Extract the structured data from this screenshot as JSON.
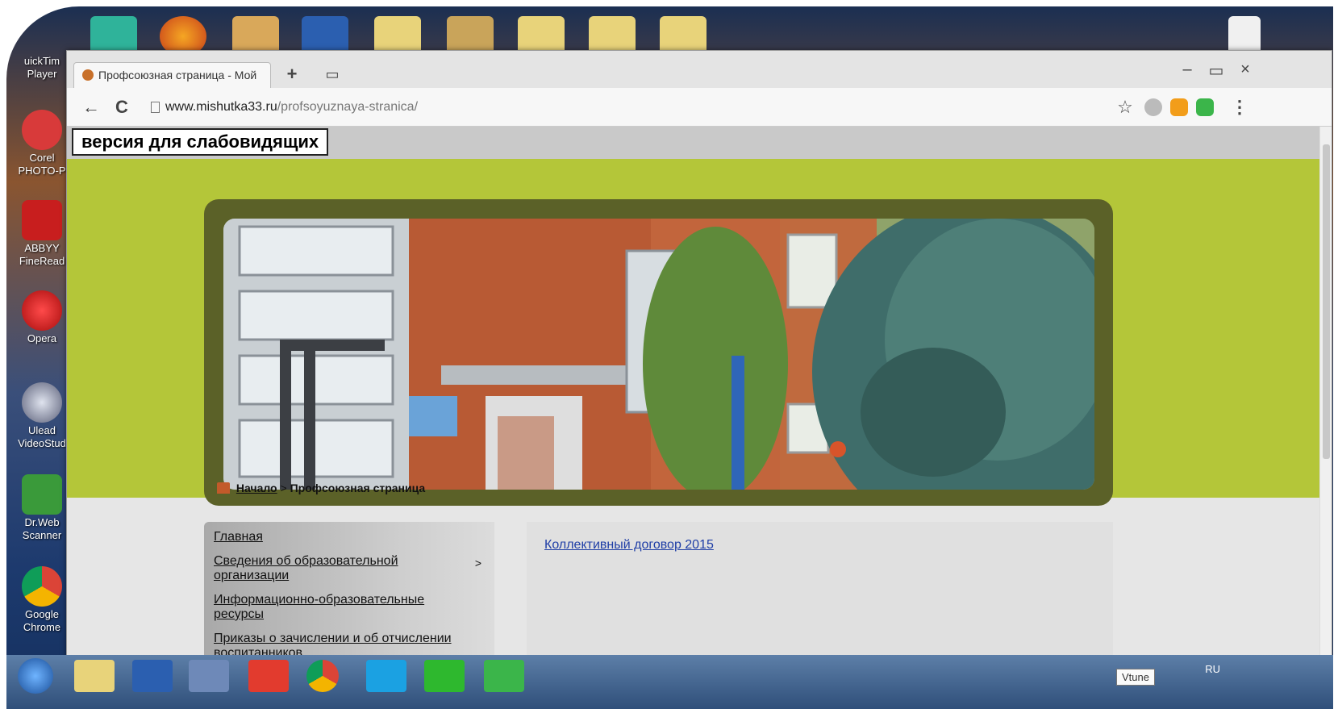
{
  "desktop": {
    "icons": [
      {
        "label": "uickTim\nPlayer",
        "color": "#3a6fd8"
      },
      {
        "label": "Corel\nPHOTO-P",
        "color": "#d83a3a"
      },
      {
        "label": "ABBYY\nFineRead",
        "color": "#c81e1e"
      },
      {
        "label": "Opera",
        "color": "#cc1a1a"
      },
      {
        "label": "Ulead\nVideoStud",
        "color": "#8a8a9a"
      },
      {
        "label": "Dr.Web\nScanner",
        "color": "#3a9a3a"
      },
      {
        "label": "Google\nChrome",
        "color": "#e8b422"
      }
    ]
  },
  "browser": {
    "tab_title": "Профсоюзная страница - Мой",
    "new_tab": "+",
    "url_host": "www.mishutka33.ru",
    "url_path": "/profsoyuznaya-stranica/",
    "win_min": "–",
    "win_max": "▭",
    "win_close": "×",
    "back": "←",
    "reload": "C",
    "star": "☆",
    "menu": "⋮"
  },
  "page": {
    "vision_impaired": "версия для слабовидящих",
    "breadcrumb_home": "Начало",
    "breadcrumb_sep": ">",
    "breadcrumb_current": "Профсоюзная страница",
    "menu": [
      {
        "label": "Главная",
        "arrow": ""
      },
      {
        "label": "Сведения об образовательной организации",
        "arrow": ">"
      },
      {
        "label": "Информационно-образовательные ресурсы",
        "arrow": ""
      },
      {
        "label": "Приказы о зачислении и об отчислении воспитанников",
        "arrow": ""
      }
    ],
    "content_link": "Коллективный договор 2015"
  },
  "taskbar": {
    "tray_lang": "RU",
    "tooltip": "Vtune"
  }
}
